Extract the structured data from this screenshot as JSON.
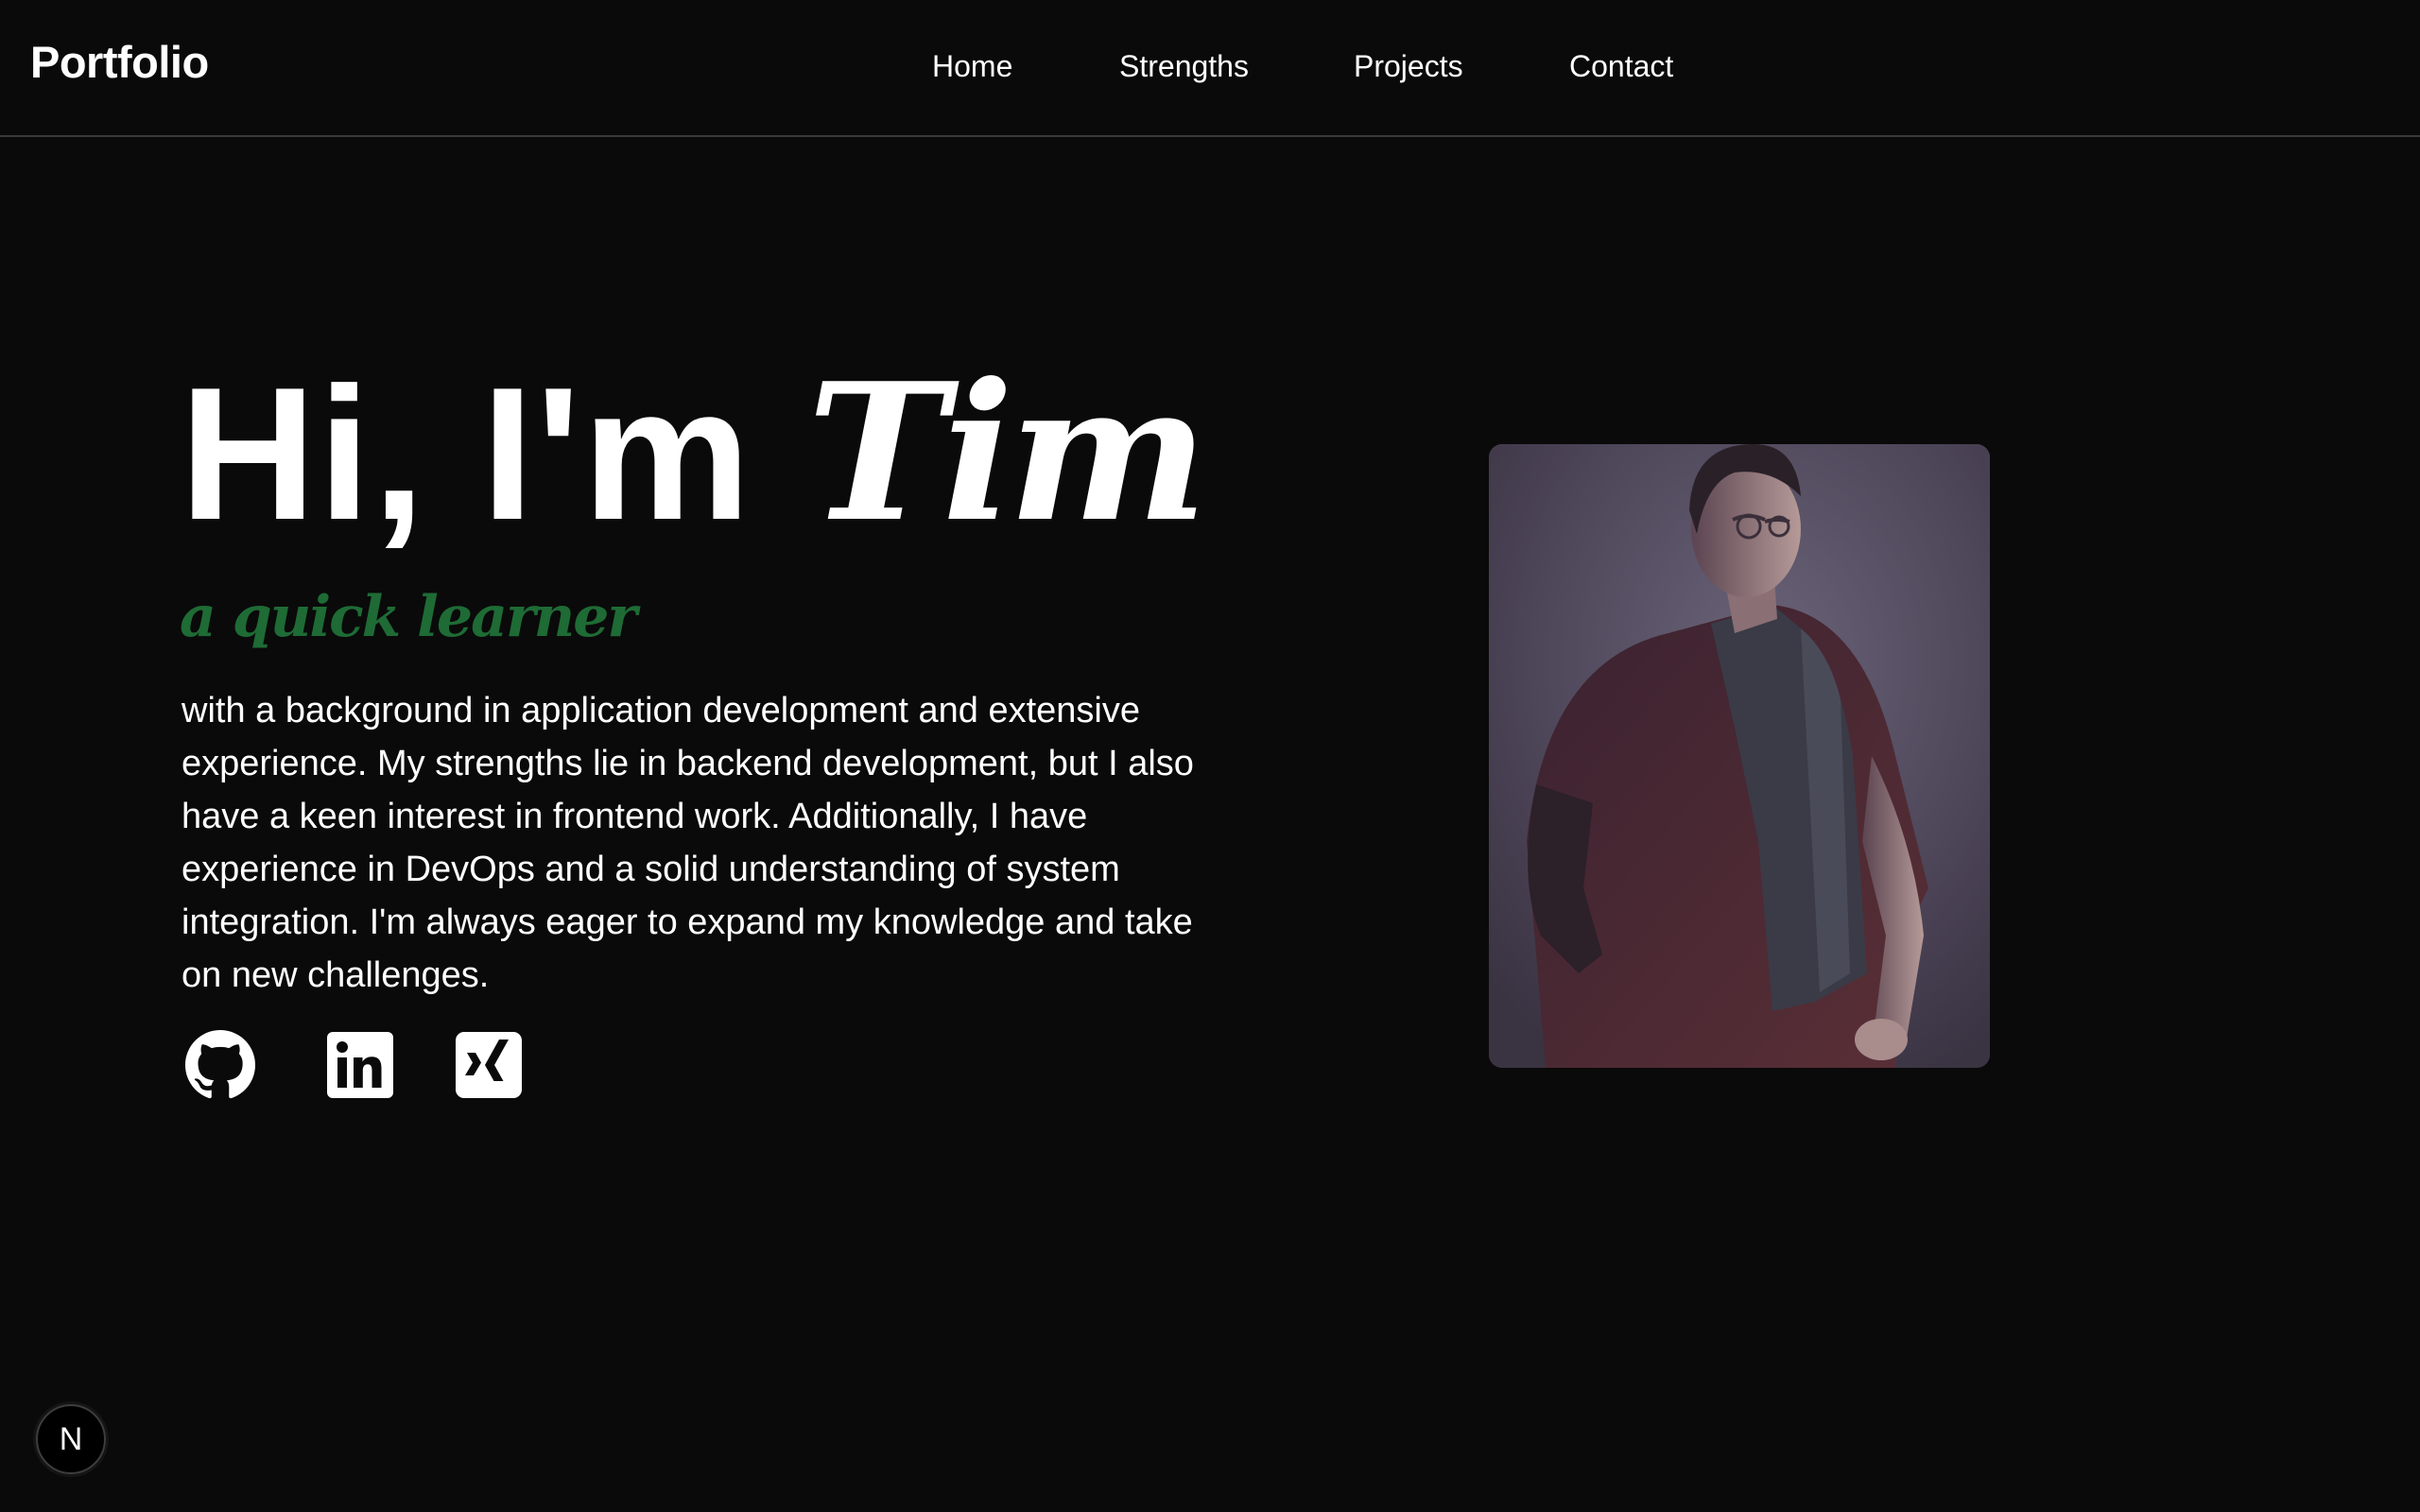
{
  "nav": {
    "brand": "Portfolio",
    "links": [
      "Home",
      "Strengths",
      "Projects",
      "Contact"
    ]
  },
  "hero": {
    "greeting": "Hi, I'm ",
    "name": "Tim",
    "tagline": "a quick learner",
    "bio": "with a background in application development and extensive experience. My strengths lie in backend development, but I also have a keen interest in frontend work. Additionally, I have experience in DevOps and a solid understanding of system integration. I'm always eager to expand my knowledge and take on new challenges."
  },
  "socials": [
    {
      "icon": "github-icon"
    },
    {
      "icon": "linkedin-icon"
    },
    {
      "icon": "xing-icon"
    }
  ],
  "portrait": {
    "icon": "portrait-photo"
  },
  "dev_badge": {
    "label": "N",
    "icon": "nextjs-icon"
  },
  "colors": {
    "background": "#0a0a0a",
    "text": "#ffffff",
    "accent": "#1e6b35",
    "divider": "#3a3a3a"
  }
}
